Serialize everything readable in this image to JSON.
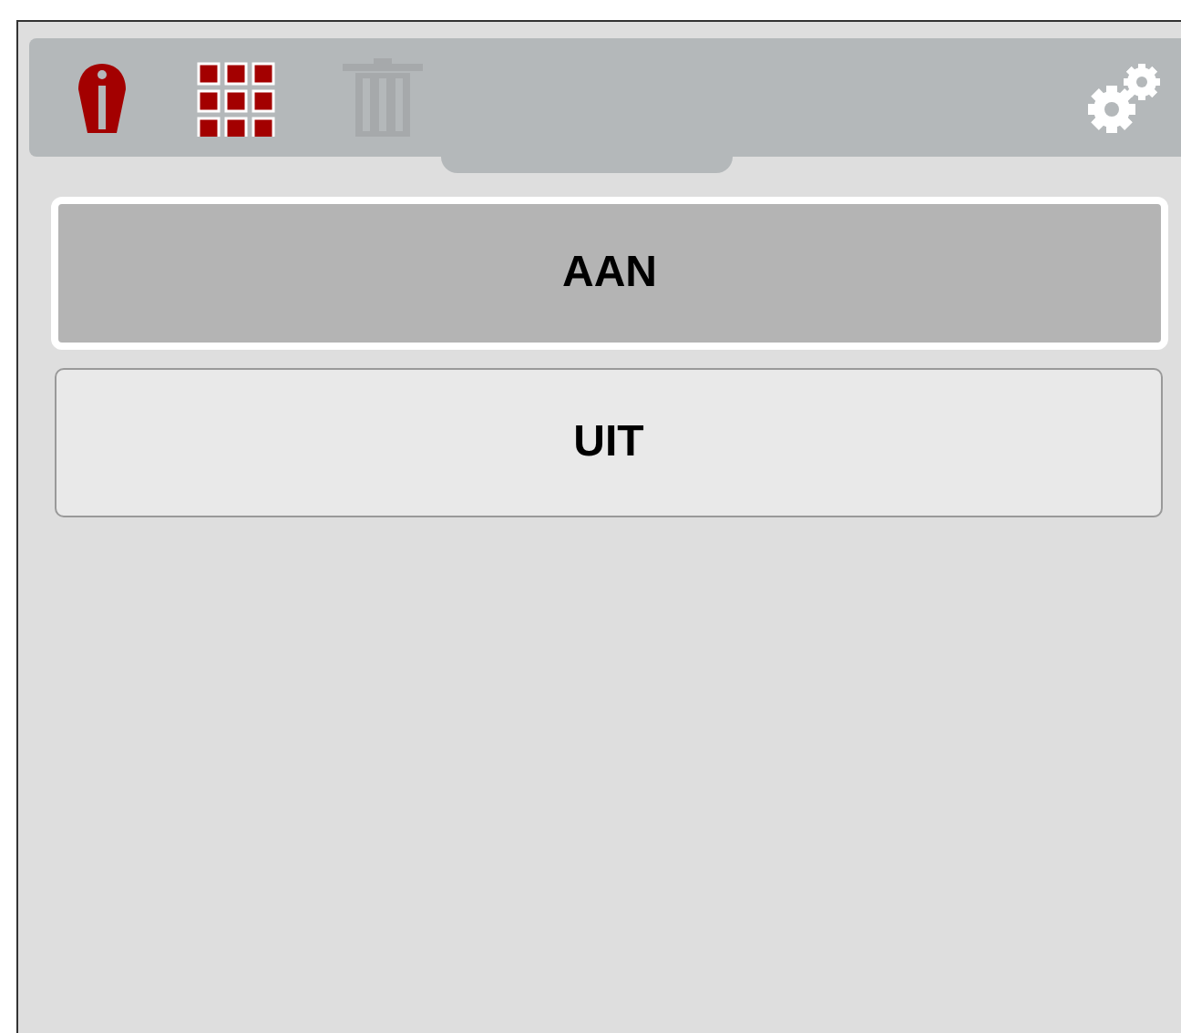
{
  "toolbar": {
    "tools": [
      {
        "kind": "info",
        "disabled": false
      },
      {
        "kind": "grid",
        "disabled": false
      },
      {
        "kind": "trash",
        "disabled": true
      },
      {
        "kind": "settings",
        "disabled": false
      }
    ]
  },
  "options": [
    {
      "label": "AAN",
      "selected": true
    },
    {
      "label": "UIT",
      "selected": false
    }
  ]
}
